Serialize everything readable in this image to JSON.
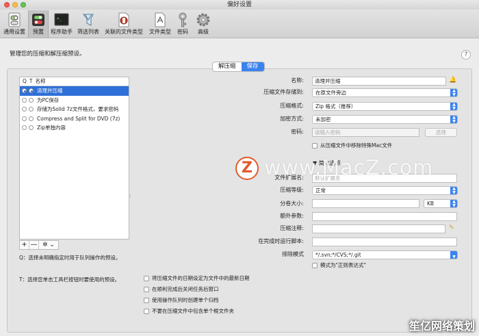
{
  "window": {
    "title": "偏好设置"
  },
  "toolbar": [
    {
      "label": "通用设置",
      "icon": "switch-icon"
    },
    {
      "label": "预置",
      "icon": "presets-icon"
    },
    {
      "label": "程序助手",
      "icon": "terminal-icon"
    },
    {
      "label": "筛选列表",
      "icon": "filter-icon"
    },
    {
      "label": "关联的文件类型",
      "icon": "file-association-icon"
    },
    {
      "label": "文件类型",
      "icon": "file-type-icon"
    },
    {
      "label": "密码",
      "icon": "key-icon"
    },
    {
      "label": "高级",
      "icon": "gear-icon"
    }
  ],
  "description": "管理您的压缩和解压缩预设。",
  "help": "?",
  "tabs": [
    {
      "label": "解压缩"
    },
    {
      "label": "保存"
    }
  ],
  "preset_list": {
    "header": {
      "q": "Q",
      "t": "T",
      "name": "名称"
    },
    "items": [
      {
        "label": "清理并压缩"
      },
      {
        "label": "为PC保存"
      },
      {
        "label": "存储为Solid 7z文件格式，要求密码"
      },
      {
        "label": "Compress and Split for DVD (7z)"
      },
      {
        "label": "Zip单独内容"
      }
    ],
    "buttons": {
      "add": "+",
      "remove": "—",
      "gear": "✲ ⌄"
    }
  },
  "hints": {
    "q": "Q：选择未明确指定时用于队列操作的预设。",
    "t": "T：选择您单击工具栏按钮时要使用的预设。"
  },
  "form": {
    "name": {
      "label": "名称:",
      "value": "清理并压缩"
    },
    "save_location": {
      "label": "压缩文件存储到:",
      "value": "在原文件旁边"
    },
    "format": {
      "label": "压缩格式:",
      "value": "Zip 格式（推荐）"
    },
    "encryption": {
      "label": "加密方式:",
      "value": "未加密"
    },
    "password": {
      "label": "密码:",
      "placeholder": "请输入密码",
      "button": "选择"
    },
    "remove_mac": {
      "label": "从压缩文件中移除特殊Mac文件"
    },
    "simplify": {
      "label": "▼ 简化选项"
    },
    "extension": {
      "label": "文件扩展名:",
      "placeholder": "默认扩展名"
    },
    "level": {
      "label": "压缩等级:",
      "value": "正常"
    },
    "split": {
      "label": "分卷大小:",
      "value": "",
      "unit": "KB"
    },
    "extra": {
      "label": "额外参数:",
      "value": ""
    },
    "comment": {
      "label": "压缩注释:",
      "value": ""
    },
    "run_script": {
      "label": "在完成时运行脚本:",
      "value": ""
    },
    "exclude": {
      "label": "排除模式",
      "value": "*/.svn;*/CVS;*/.git"
    },
    "regex": {
      "label": "模式为\"正则表达式\""
    }
  },
  "checks": [
    {
      "label": "将压缩文件的日期设定为文件中的最新日期"
    },
    {
      "label": "在顺利完成后关闭任务后窗口"
    },
    {
      "label": "使用操作队列时创建单个归档"
    },
    {
      "label": "不要在压缩文件中包含单个根文件夹"
    }
  ],
  "watermark": {
    "logo": "Z",
    "text": "www.MacZ.com",
    "corner": "笙亿网络策划"
  }
}
